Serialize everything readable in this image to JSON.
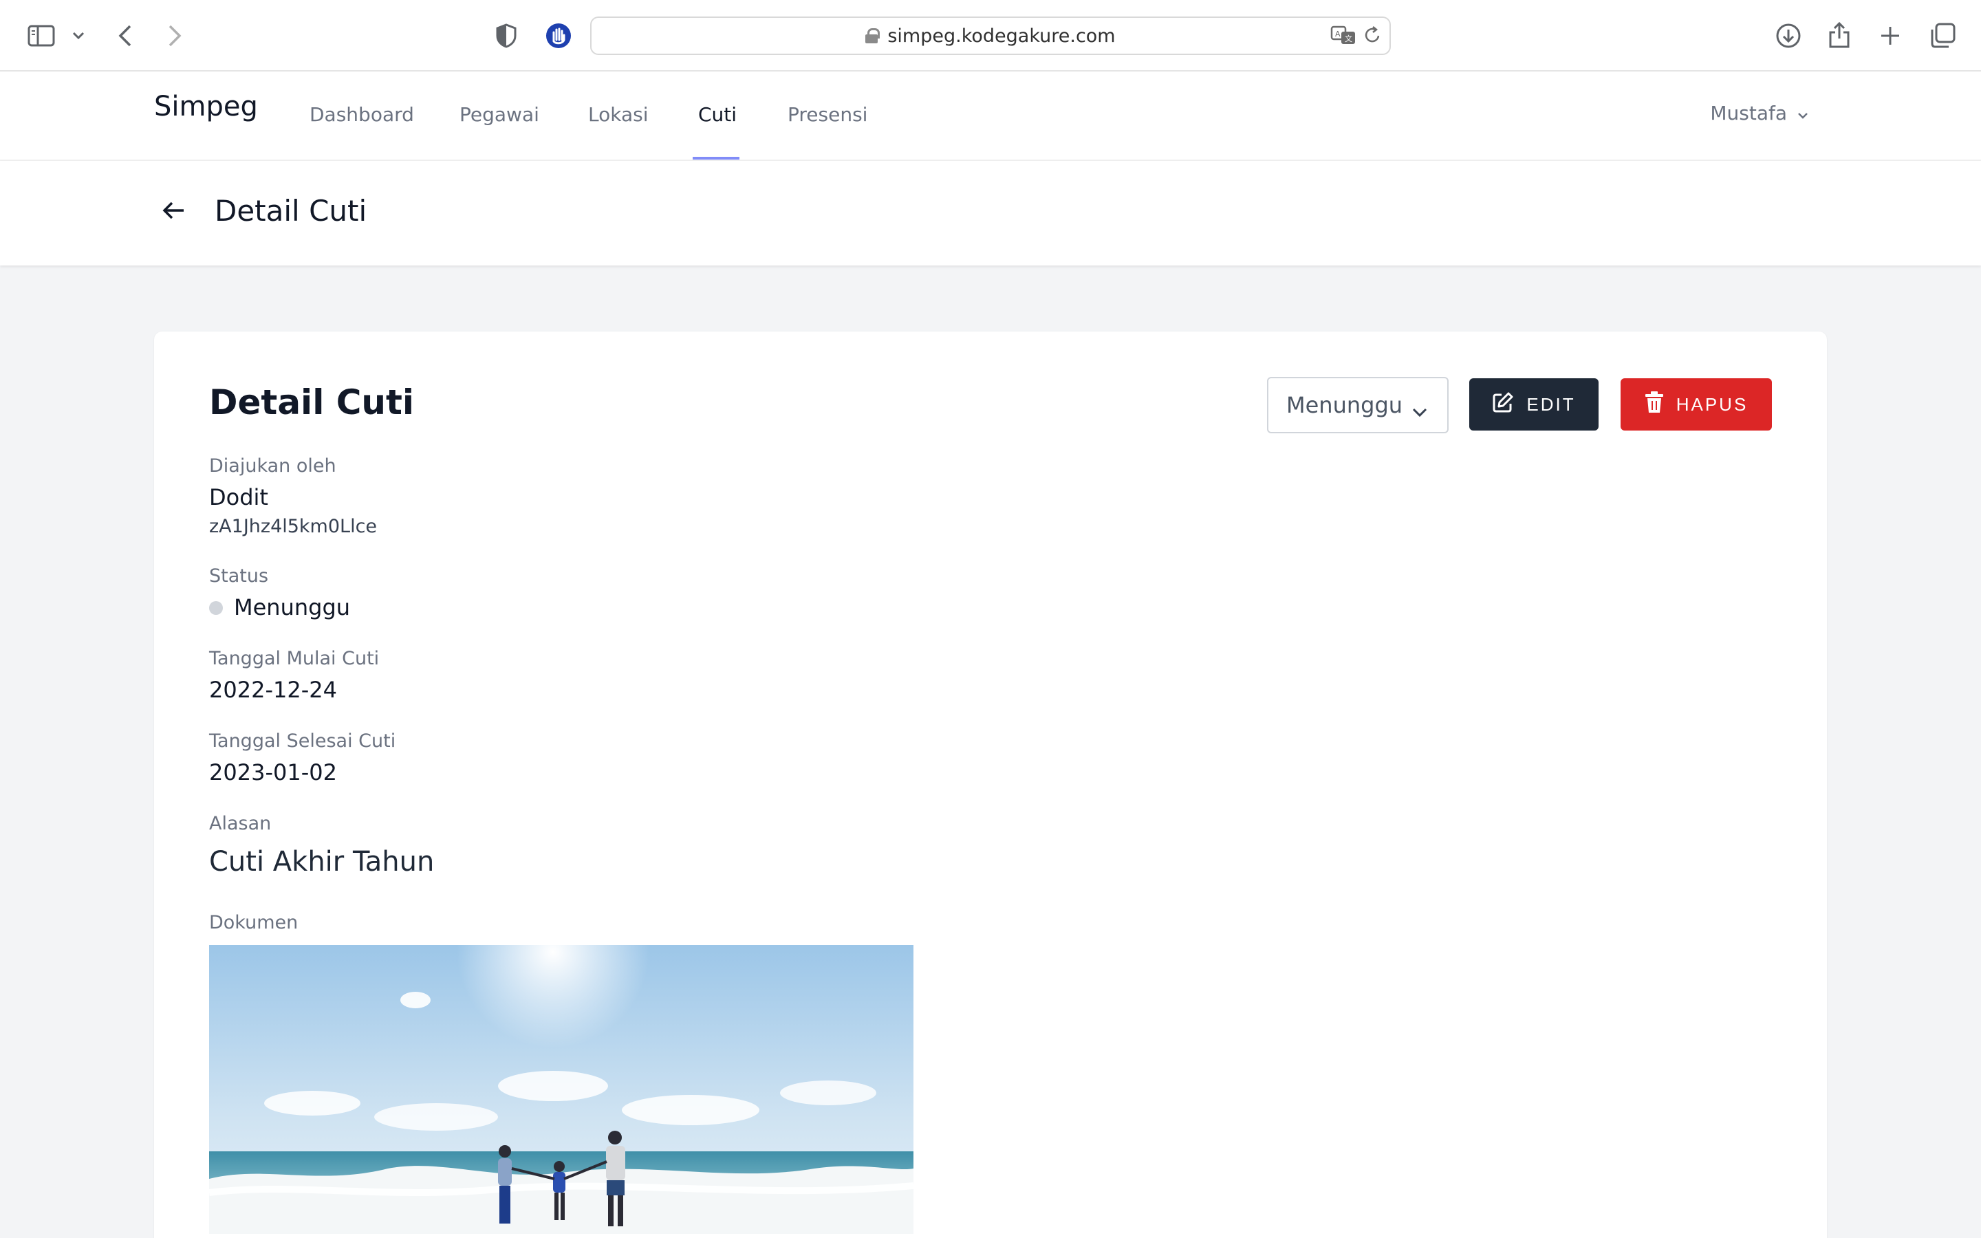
{
  "browser": {
    "url": "simpeg.kodegakure.com"
  },
  "nav": {
    "brand": "Simpeg",
    "links": [
      "Dashboard",
      "Pegawai",
      "Lokasi",
      "Cuti",
      "Presensi"
    ],
    "active": "Cuti",
    "user": "Mustafa"
  },
  "header": {
    "title": "Detail Cuti"
  },
  "card": {
    "title": "Detail Cuti",
    "status_select": "Menunggu",
    "edit_label": "EDIT",
    "delete_label": "HAPUS",
    "fields": {
      "submitted_by_label": "Diajukan oleh",
      "submitted_by_name": "Dodit",
      "submitted_by_id": "zA1Jhz4l5km0Llce",
      "status_label": "Status",
      "status_value": "Menunggu",
      "start_label": "Tanggal Mulai Cuti",
      "start_value": "2022-12-24",
      "end_label": "Tanggal Selesai Cuti",
      "end_value": "2023-01-02",
      "reason_label": "Alasan",
      "reason_value": "Cuti Akhir Tahun",
      "document_label": "Dokumen"
    }
  },
  "colors": {
    "active_tab": "#818cf8",
    "edit_button": "#1f2937",
    "delete_button": "#dc2626",
    "status_dot": "#d1d5db"
  }
}
